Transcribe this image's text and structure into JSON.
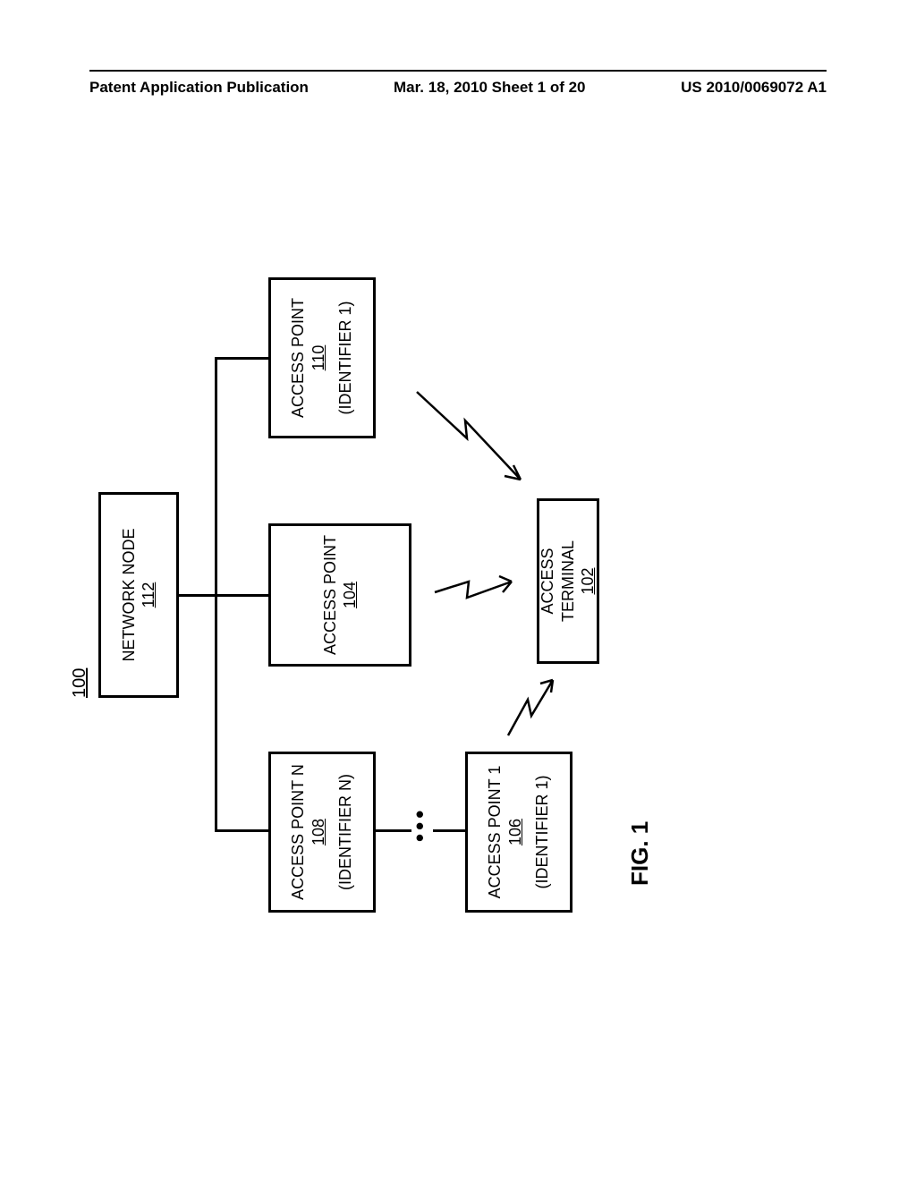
{
  "header": {
    "left": "Patent Application Publication",
    "mid": "Mar. 18, 2010  Sheet 1 of 20",
    "right": "US 2010/0069072 A1"
  },
  "figure_label": "FIG. 1",
  "system_ref": "100",
  "nodes": {
    "network": {
      "title": "NETWORK NODE",
      "ref": "112"
    },
    "ap_n": {
      "title": "ACCESS POINT N",
      "ref": "108",
      "id": "(IDENTIFIER N)"
    },
    "ap_104": {
      "title": "ACCESS POINT",
      "ref": "104"
    },
    "ap_110": {
      "title": "ACCESS POINT",
      "ref": "110",
      "id": "(IDENTIFIER 1)"
    },
    "ap_1": {
      "title": "ACCESS POINT 1",
      "ref": "106",
      "id": "(IDENTIFIER 1)"
    },
    "terminal": {
      "title": "ACCESS TERMINAL",
      "ref": "102"
    }
  },
  "chart_data": {
    "type": "diagram",
    "title": "FIG. 1",
    "system_reference": "100",
    "blocks": [
      {
        "ref": "112",
        "label": "NETWORK NODE"
      },
      {
        "ref": "108",
        "label": "ACCESS POINT N",
        "identifier": "IDENTIFIER N"
      },
      {
        "ref": "104",
        "label": "ACCESS POINT"
      },
      {
        "ref": "110",
        "label": "ACCESS POINT",
        "identifier": "IDENTIFIER 1"
      },
      {
        "ref": "106",
        "label": "ACCESS POINT 1",
        "identifier": "IDENTIFIER 1"
      },
      {
        "ref": "102",
        "label": "ACCESS TERMINAL"
      }
    ],
    "wired_connections": [
      [
        "112",
        "108"
      ],
      [
        "112",
        "104"
      ],
      [
        "112",
        "110"
      ],
      [
        "108",
        "106",
        "via-ellipsis"
      ]
    ],
    "wireless_connections": [
      [
        "106",
        "102"
      ],
      [
        "104",
        "102"
      ],
      [
        "110",
        "102"
      ]
    ]
  }
}
